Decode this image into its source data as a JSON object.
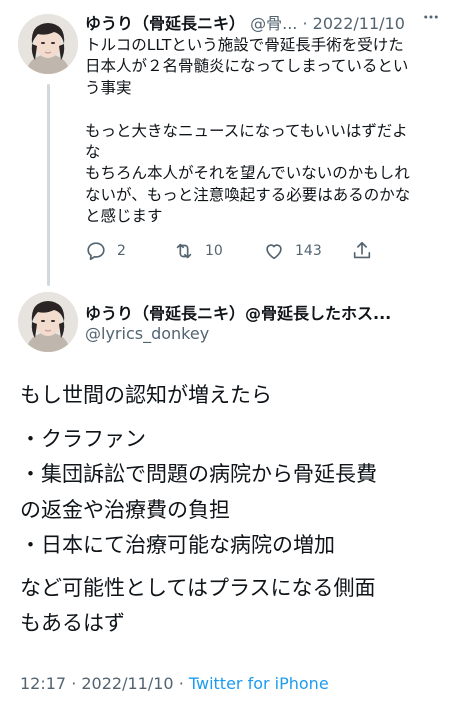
{
  "parent_tweet": {
    "display_name": "ゆうり（骨延長ニキ）",
    "handle_truncated": "@骨...",
    "separator": "·",
    "date": "2022/11/10",
    "more_icon": "more-horizontal-icon",
    "text_lines": [
      "トルコのLLTという施設で骨延長手術を受けた",
      "日本人が２名骨髄炎になってしまっているとい",
      "う事実",
      "",
      "もっと大きなニュースになってもいいはずだよ",
      "な",
      "もちろん本人がそれを望んでいないのかもしれ",
      "ないが、もっと注意喚起する必要はあるのかな",
      "と感じます"
    ],
    "actions": {
      "reply_count": "2",
      "retweet_count": "10",
      "like_count": "143"
    }
  },
  "main_tweet": {
    "display_name": "ゆうり（骨延長ニキ）@骨延長したホス...",
    "handle": "@lyrics_donkey",
    "text_lines": [
      "もし世間の認知が増えたら",
      "・クラファン",
      "・集団訴訟で問題の病院から骨延長費",
      "の返金や治療費の負担",
      "・日本にて治療可能な病院の増加",
      "など可能性としてはプラスになる側面",
      "もあるはず"
    ],
    "time": "12:17",
    "date": "2022/11/10",
    "source": "Twitter for iPhone"
  },
  "colors": {
    "text": "#0f1419",
    "secondary": "#536471",
    "link": "#1d9bf0",
    "thread_line": "#cfd9de"
  }
}
